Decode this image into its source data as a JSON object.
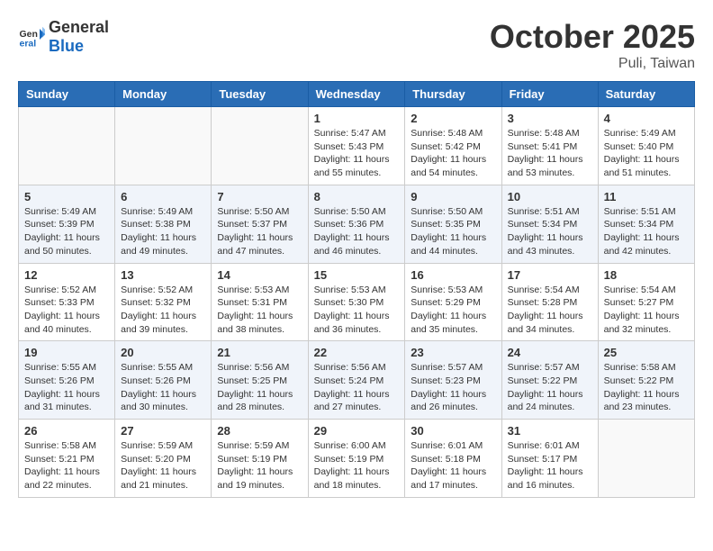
{
  "header": {
    "logo_general": "General",
    "logo_blue": "Blue",
    "month_title": "October 2025",
    "location": "Puli, Taiwan"
  },
  "weekdays": [
    "Sunday",
    "Monday",
    "Tuesday",
    "Wednesday",
    "Thursday",
    "Friday",
    "Saturday"
  ],
  "weeks": [
    [
      {
        "day": "",
        "info": ""
      },
      {
        "day": "",
        "info": ""
      },
      {
        "day": "",
        "info": ""
      },
      {
        "day": "1",
        "info": "Sunrise: 5:47 AM\nSunset: 5:43 PM\nDaylight: 11 hours and 55 minutes."
      },
      {
        "day": "2",
        "info": "Sunrise: 5:48 AM\nSunset: 5:42 PM\nDaylight: 11 hours and 54 minutes."
      },
      {
        "day": "3",
        "info": "Sunrise: 5:48 AM\nSunset: 5:41 PM\nDaylight: 11 hours and 53 minutes."
      },
      {
        "day": "4",
        "info": "Sunrise: 5:49 AM\nSunset: 5:40 PM\nDaylight: 11 hours and 51 minutes."
      }
    ],
    [
      {
        "day": "5",
        "info": "Sunrise: 5:49 AM\nSunset: 5:39 PM\nDaylight: 11 hours and 50 minutes."
      },
      {
        "day": "6",
        "info": "Sunrise: 5:49 AM\nSunset: 5:38 PM\nDaylight: 11 hours and 49 minutes."
      },
      {
        "day": "7",
        "info": "Sunrise: 5:50 AM\nSunset: 5:37 PM\nDaylight: 11 hours and 47 minutes."
      },
      {
        "day": "8",
        "info": "Sunrise: 5:50 AM\nSunset: 5:36 PM\nDaylight: 11 hours and 46 minutes."
      },
      {
        "day": "9",
        "info": "Sunrise: 5:50 AM\nSunset: 5:35 PM\nDaylight: 11 hours and 44 minutes."
      },
      {
        "day": "10",
        "info": "Sunrise: 5:51 AM\nSunset: 5:34 PM\nDaylight: 11 hours and 43 minutes."
      },
      {
        "day": "11",
        "info": "Sunrise: 5:51 AM\nSunset: 5:34 PM\nDaylight: 11 hours and 42 minutes."
      }
    ],
    [
      {
        "day": "12",
        "info": "Sunrise: 5:52 AM\nSunset: 5:33 PM\nDaylight: 11 hours and 40 minutes."
      },
      {
        "day": "13",
        "info": "Sunrise: 5:52 AM\nSunset: 5:32 PM\nDaylight: 11 hours and 39 minutes."
      },
      {
        "day": "14",
        "info": "Sunrise: 5:53 AM\nSunset: 5:31 PM\nDaylight: 11 hours and 38 minutes."
      },
      {
        "day": "15",
        "info": "Sunrise: 5:53 AM\nSunset: 5:30 PM\nDaylight: 11 hours and 36 minutes."
      },
      {
        "day": "16",
        "info": "Sunrise: 5:53 AM\nSunset: 5:29 PM\nDaylight: 11 hours and 35 minutes."
      },
      {
        "day": "17",
        "info": "Sunrise: 5:54 AM\nSunset: 5:28 PM\nDaylight: 11 hours and 34 minutes."
      },
      {
        "day": "18",
        "info": "Sunrise: 5:54 AM\nSunset: 5:27 PM\nDaylight: 11 hours and 32 minutes."
      }
    ],
    [
      {
        "day": "19",
        "info": "Sunrise: 5:55 AM\nSunset: 5:26 PM\nDaylight: 11 hours and 31 minutes."
      },
      {
        "day": "20",
        "info": "Sunrise: 5:55 AM\nSunset: 5:26 PM\nDaylight: 11 hours and 30 minutes."
      },
      {
        "day": "21",
        "info": "Sunrise: 5:56 AM\nSunset: 5:25 PM\nDaylight: 11 hours and 28 minutes."
      },
      {
        "day": "22",
        "info": "Sunrise: 5:56 AM\nSunset: 5:24 PM\nDaylight: 11 hours and 27 minutes."
      },
      {
        "day": "23",
        "info": "Sunrise: 5:57 AM\nSunset: 5:23 PM\nDaylight: 11 hours and 26 minutes."
      },
      {
        "day": "24",
        "info": "Sunrise: 5:57 AM\nSunset: 5:22 PM\nDaylight: 11 hours and 24 minutes."
      },
      {
        "day": "25",
        "info": "Sunrise: 5:58 AM\nSunset: 5:22 PM\nDaylight: 11 hours and 23 minutes."
      }
    ],
    [
      {
        "day": "26",
        "info": "Sunrise: 5:58 AM\nSunset: 5:21 PM\nDaylight: 11 hours and 22 minutes."
      },
      {
        "day": "27",
        "info": "Sunrise: 5:59 AM\nSunset: 5:20 PM\nDaylight: 11 hours and 21 minutes."
      },
      {
        "day": "28",
        "info": "Sunrise: 5:59 AM\nSunset: 5:19 PM\nDaylight: 11 hours and 19 minutes."
      },
      {
        "day": "29",
        "info": "Sunrise: 6:00 AM\nSunset: 5:19 PM\nDaylight: 11 hours and 18 minutes."
      },
      {
        "day": "30",
        "info": "Sunrise: 6:01 AM\nSunset: 5:18 PM\nDaylight: 11 hours and 17 minutes."
      },
      {
        "day": "31",
        "info": "Sunrise: 6:01 AM\nSunset: 5:17 PM\nDaylight: 11 hours and 16 minutes."
      },
      {
        "day": "",
        "info": ""
      }
    ]
  ]
}
